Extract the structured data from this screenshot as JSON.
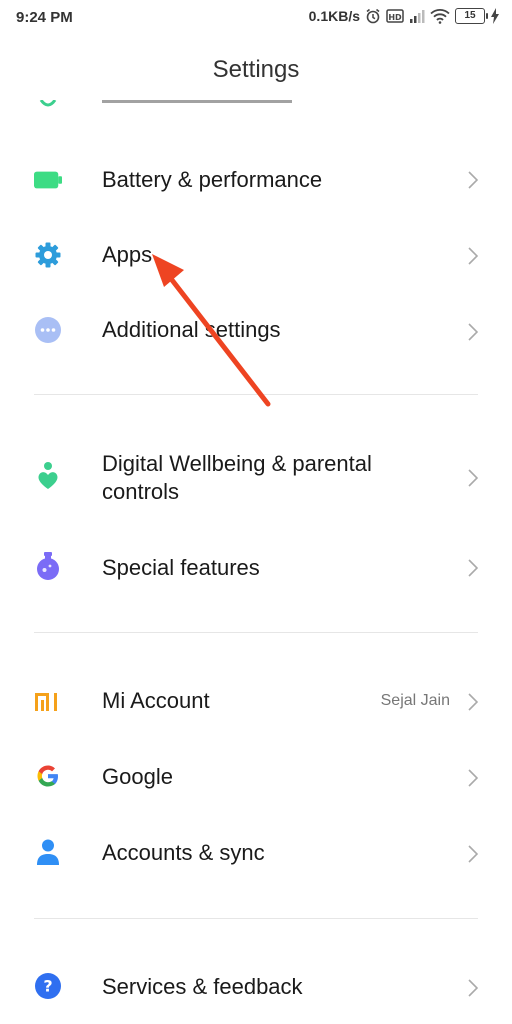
{
  "status_bar": {
    "time": "9:24 PM",
    "speed": "0.1KB/s",
    "battery": "15"
  },
  "header": {
    "title": "Settings"
  },
  "items": [
    {
      "label": "Battery & performance",
      "icon": "battery-icon"
    },
    {
      "label": "Apps",
      "icon": "gear-icon"
    },
    {
      "label": "Additional settings",
      "icon": "more-dots-icon"
    },
    {
      "label": "Digital Wellbeing & parental controls",
      "label_line1": "Digital Wellbeing & parental",
      "label_line2": "controls",
      "icon": "wellbeing-icon"
    },
    {
      "label": "Special features",
      "icon": "flask-icon"
    },
    {
      "label": "Mi Account",
      "trail": "Sejal Jain",
      "icon": "mi-logo-icon"
    },
    {
      "label": "Google",
      "icon": "google-icon"
    },
    {
      "label": "Accounts & sync",
      "icon": "person-icon"
    },
    {
      "label": "Services & feedback",
      "icon": "help-icon"
    }
  ],
  "colors": {
    "battery_green": "#3ddc84",
    "apps_blue": "#2d9cdb",
    "additional_blue": "#a9bff5",
    "wellbeing_green": "#3ccf8e",
    "special_purple": "#7b6cf6",
    "mi_orange": "#f5a11a",
    "accounts_blue": "#2f8ff5",
    "help_blue": "#2f6ff0",
    "annotation_red": "#ee4422"
  }
}
